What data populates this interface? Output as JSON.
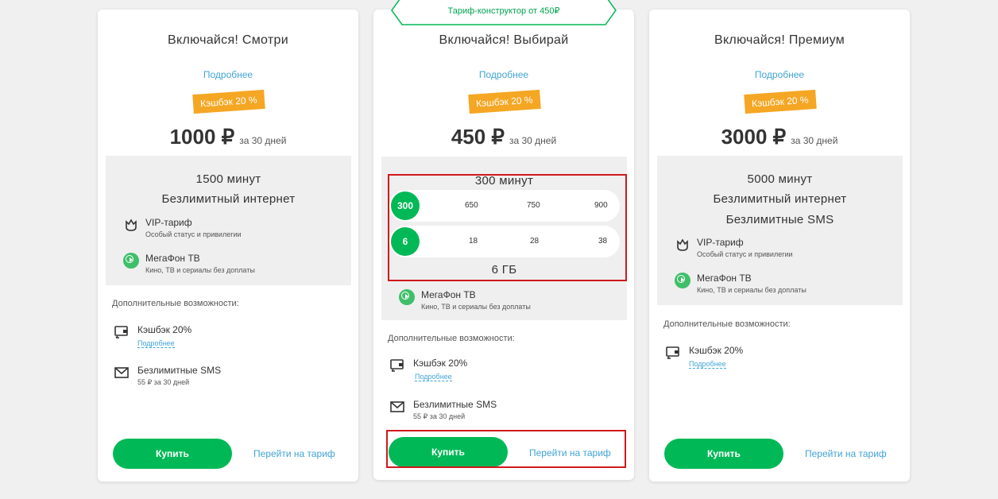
{
  "badge": "Тариф-конструктор от 450₽",
  "common": {
    "more": "Подробнее",
    "cashback_tag": "Кэшбэк 20 %",
    "per": "за 30 дней",
    "extra_title": "Дополнительные возможности:",
    "buy": "Купить",
    "go": "Перейти на тариф"
  },
  "plans": [
    {
      "title": "Включайся! Смотри",
      "price": "1000 ₽",
      "lines": [
        "1500 минут",
        "Безлимитный интернет"
      ],
      "features": [
        {
          "name": "VIP-тариф",
          "desc": "Особый статус и привилегии",
          "icon": "crown-icon"
        },
        {
          "name": "МегаФон ТВ",
          "desc": "Кино, ТВ и сериалы без доплаты",
          "icon": "play-icon"
        }
      ],
      "extras": [
        {
          "name": "Кэшбэк 20%",
          "link": "Подробнее",
          "icon": "wallet-icon"
        },
        {
          "name": "Безлимитные SMS",
          "desc": "55 ₽ за 30 дней",
          "icon": "mail-icon"
        }
      ]
    },
    {
      "title": "Включайся! Выбирай",
      "price": "450 ₽",
      "minutes_title": "300 минут",
      "minutes_options": [
        "300",
        "650",
        "750",
        "900"
      ],
      "minutes_selected": "300",
      "gb_options": [
        "6",
        "18",
        "28",
        "38"
      ],
      "gb_selected": "6",
      "gb_title": "6 ГБ",
      "features": [
        {
          "name": "МегаФон ТВ",
          "desc": "Кино, ТВ и сериалы без доплаты",
          "icon": "play-icon"
        }
      ],
      "extras": [
        {
          "name": "Кэшбэк 20%",
          "link": "Подробнее",
          "icon": "wallet-icon"
        },
        {
          "name": "Безлимитные SMS",
          "desc": "55 ₽ за 30 дней",
          "icon": "mail-icon"
        }
      ]
    },
    {
      "title": "Включайся! Премиум",
      "price": "3000 ₽",
      "lines": [
        "5000 минут",
        "Безлимитный интернет",
        "Безлимитные SMS"
      ],
      "features": [
        {
          "name": "VIP-тариф",
          "desc": "Особый статус и привилегии",
          "icon": "crown-icon"
        },
        {
          "name": "МегаФон ТВ",
          "desc": "Кино, ТВ и сериалы без доплаты",
          "icon": "play-icon"
        }
      ],
      "extras": [
        {
          "name": "Кэшбэк 20%",
          "link": "Подробнее",
          "icon": "wallet-icon"
        }
      ]
    }
  ],
  "colors": {
    "accent": "#00b956",
    "link": "#41a4d6",
    "cashback": "#f5a623",
    "highlight": "#d0191c"
  }
}
